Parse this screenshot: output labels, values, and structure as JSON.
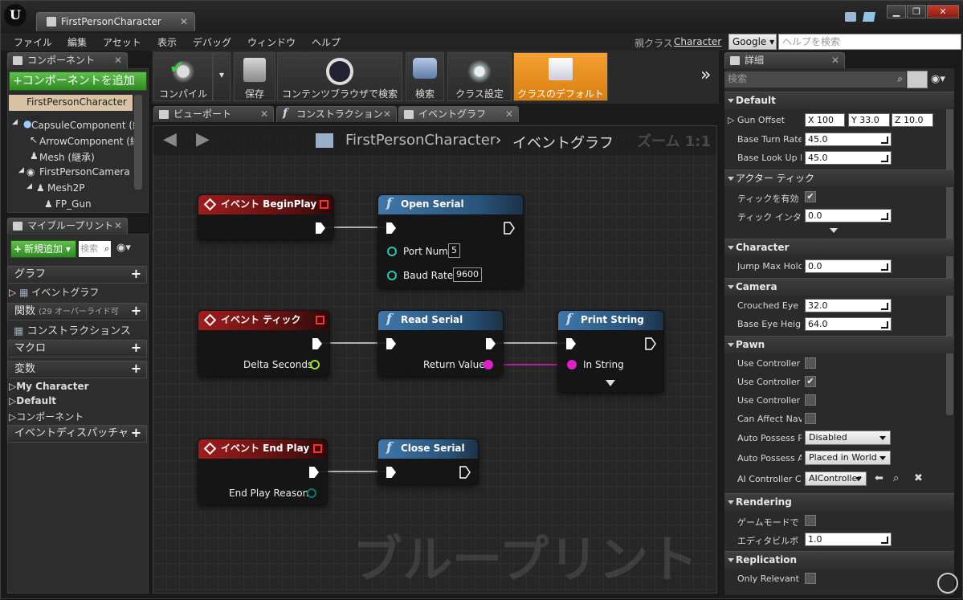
{
  "window": {
    "tab_title": "FirstPersonCharacter",
    "tab_close": "✕",
    "minimize": "▁",
    "restore": "❐",
    "close": "✕"
  },
  "menu": [
    "ファイル",
    "編集",
    "アセット",
    "表示",
    "デバッグ",
    "ウィンドウ",
    "ヘルプ"
  ],
  "parent_class": {
    "label": "親クラス",
    "value": "Character"
  },
  "search": {
    "engine": "Google",
    "placeholder": "ヘルプを検索"
  },
  "components_panel": {
    "tab": "コンポーネント",
    "close": "✕",
    "add_button": "+コンポーネントを追加",
    "root": "FirstPersonCharacter (se",
    "tree": [
      "CapsuleComponent (継",
      "ArrowComponent (継",
      "Mesh (継承)",
      "FirstPersonCamera",
      "Mesh2P",
      "FP_Gun"
    ]
  },
  "myblueprint_panel": {
    "tab": "マイブループリント",
    "close": "✕",
    "add_new": "新規追加",
    "search_placeholder": "検索",
    "sections": {
      "graphs": "グラフ",
      "event_graph": "イベントグラフ",
      "functions": "関数",
      "functions_note": "(29 オーバーライド可",
      "construction": "コンストラクションス",
      "macros": "マクロ",
      "variables": "変数",
      "var_groups": [
        "My Character",
        "Default",
        "コンポーネント"
      ],
      "dispatchers": "イベントディスパッチャ"
    }
  },
  "toolbar": {
    "compile": "コンパイル",
    "save": "保存",
    "browse": "コンテンツブラウザで検索",
    "find": "検索",
    "class_settings": "クラス設定",
    "class_defaults": "クラスのデフォルト",
    "more": "»"
  },
  "editor_tabs": [
    {
      "label": "ビューポート",
      "close": "✕"
    },
    {
      "label": "コンストラクション",
      "close": "✕"
    },
    {
      "label": "イベントグラフ",
      "close": "✕"
    }
  ],
  "graph": {
    "breadcrumb_root": "FirstPersonCharacter",
    "breadcrumb_sep": "›",
    "breadcrumb_current": "イベントグラフ",
    "zoom": "ズーム 1:1",
    "watermark": "ブループリント",
    "nodes": {
      "begin_play": {
        "title": "イベント BeginPlay"
      },
      "open_serial": {
        "title": "Open Serial",
        "port_label": "Port Num",
        "port_value": "5",
        "baud_label": "Baud Rate",
        "baud_value": "9600"
      },
      "tick": {
        "title": "イベント ティック",
        "delta": "Delta Seconds"
      },
      "read_serial": {
        "title": "Read Serial",
        "ret": "Return Value"
      },
      "print_string": {
        "title": "Print String",
        "in": "In String"
      },
      "end_play": {
        "title": "イベント End Play",
        "reason": "End Play Reason"
      },
      "close_serial": {
        "title": "Close Serial"
      }
    }
  },
  "details": {
    "tab": "詳細",
    "close": "✕",
    "search_placeholder": "検索",
    "default": {
      "title": "Default",
      "gun_offset": "Gun Offset",
      "x": "X",
      "x_val": "100",
      "y": "Y",
      "y_val": "33.0",
      "z": "Z",
      "z_val": "10.0",
      "turn": "Base Turn Rate",
      "turn_val": "45.0",
      "lookup": "Base Look Up R",
      "lookup_val": "45.0"
    },
    "actor_tick": {
      "title": "アクター ティック",
      "enabled": "ティックを有効",
      "interval": "ティック インタ",
      "interval_val": "0.0"
    },
    "character": {
      "title": "Character",
      "jump": "Jump Max Hold",
      "jump_val": "0.0"
    },
    "camera": {
      "title": "Camera",
      "crouched": "Crouched Eye H",
      "crouched_val": "32.0",
      "base_eye": "Base Eye Heigh",
      "base_eye_val": "64.0"
    },
    "pawn": {
      "title": "Pawn",
      "uc1": "Use Controller R",
      "uc2": "Use Controller R",
      "uc3": "Use Controller R",
      "can_affect": "Can Affect Nav",
      "auto_possess_p": "Auto Possess P",
      "auto_possess_p_val": "Disabled",
      "auto_possess_a": "Auto Possess A",
      "auto_possess_a_val": "Placed in World",
      "ai_ctrl": "AI Controller Cl",
      "ai_ctrl_val": "AIController"
    },
    "rendering": {
      "title": "Rendering",
      "game_mode": "ゲームモードで",
      "editor_bill": "エディタビルボ",
      "editor_bill_val": "1.0"
    },
    "replication": {
      "title": "Replication",
      "only_relevant": "Only Relevant t"
    }
  }
}
